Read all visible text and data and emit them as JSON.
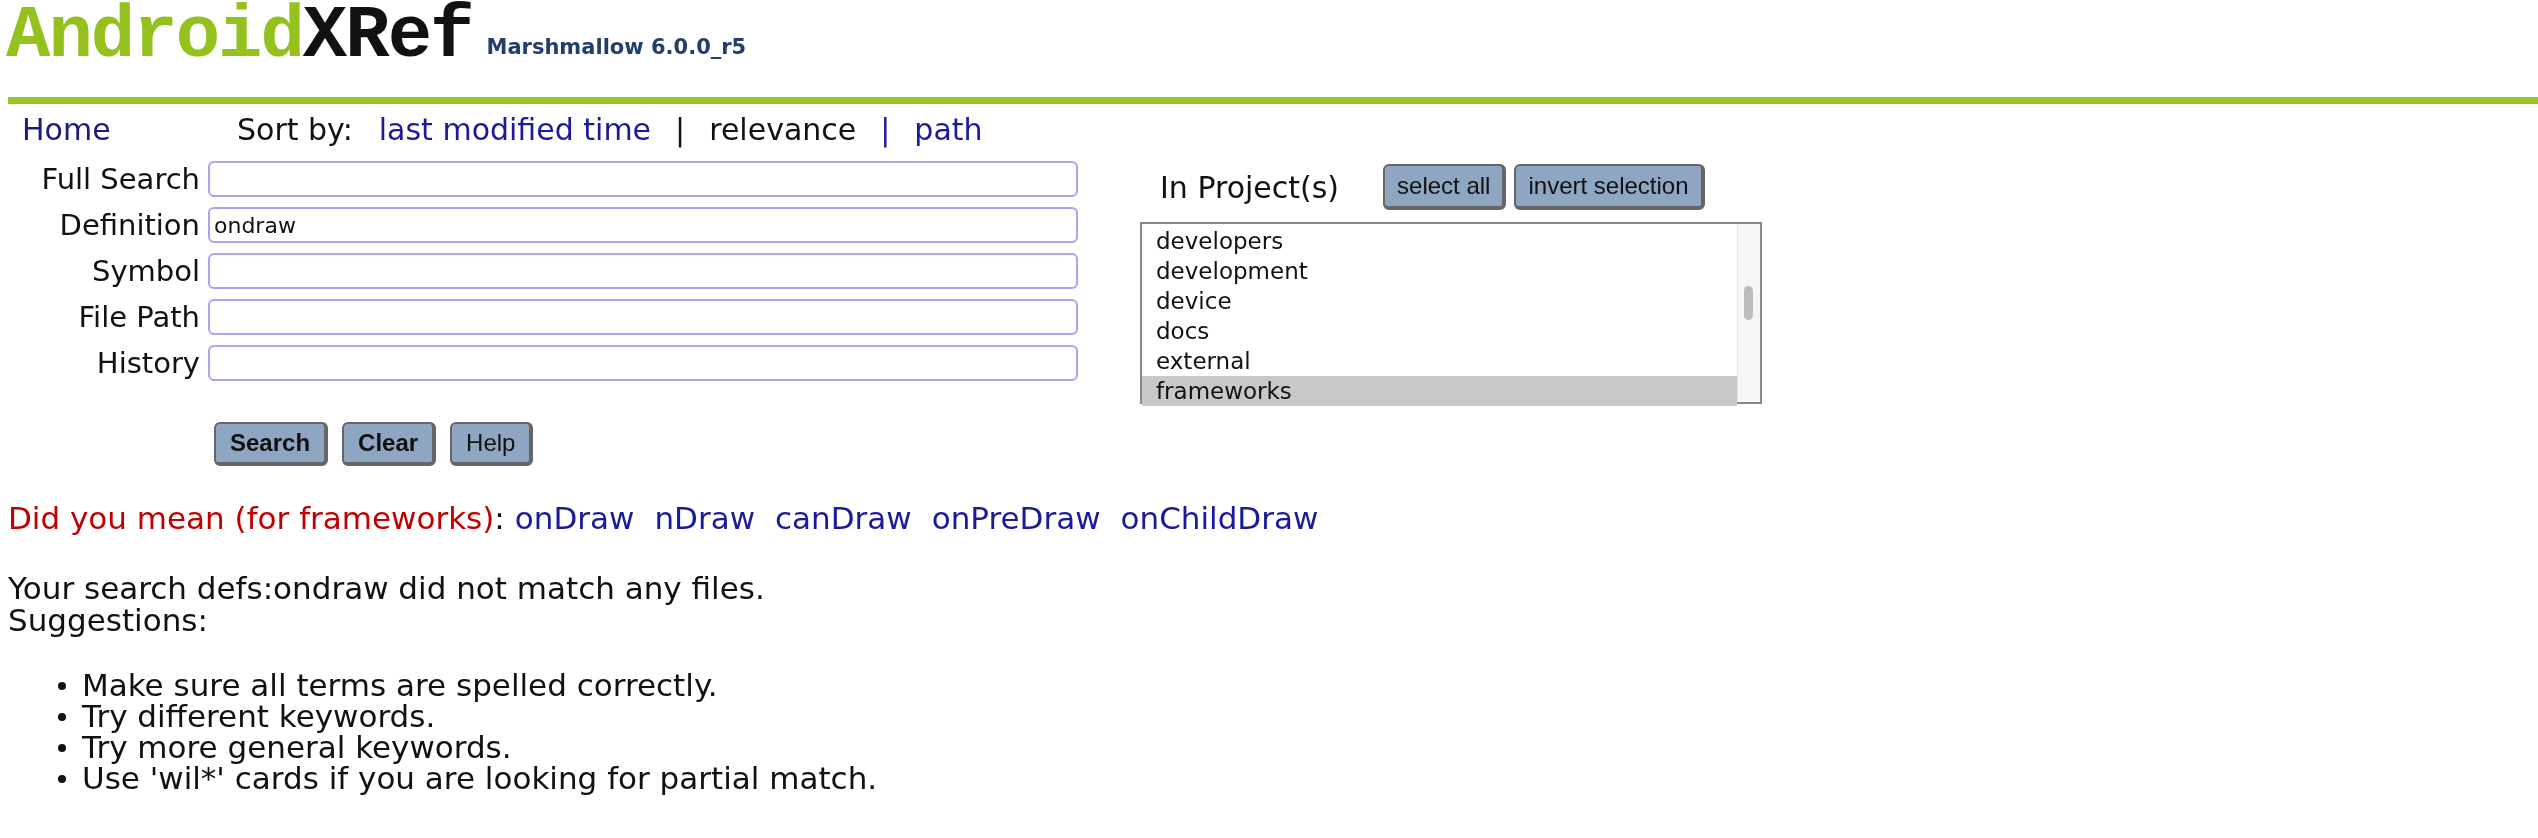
{
  "header": {
    "logo_first": "Android",
    "logo_second": "XRef",
    "version": "Marshmallow 6.0.0_r5"
  },
  "nav": {
    "home": "Home",
    "sort_label": "Sort by:",
    "sort_options": [
      {
        "label": "last modified time",
        "selected": false
      },
      {
        "label": "relevance",
        "selected": true
      },
      {
        "label": "path",
        "selected": false
      }
    ],
    "separators": [
      "|",
      "|"
    ]
  },
  "fields": [
    {
      "label": "Full Search"
    },
    {
      "label": "Definition",
      "value": "ondraw"
    },
    {
      "label": "Symbol"
    },
    {
      "label": "File Path"
    },
    {
      "label": "History"
    }
  ],
  "buttons": [
    {
      "label": "Search",
      "kind": "bold"
    },
    {
      "label": "Clear",
      "kind": "bold"
    },
    {
      "label": "Help",
      "kind": "plain"
    }
  ],
  "projects": {
    "label": "In Project(s)",
    "buttons": [
      "select all",
      "invert selection"
    ],
    "items": [
      {
        "label": "developers",
        "selected": false
      },
      {
        "label": "development",
        "selected": false
      },
      {
        "label": "device",
        "selected": false
      },
      {
        "label": "docs",
        "selected": false
      },
      {
        "label": "external",
        "selected": false
      },
      {
        "label": "frameworks",
        "selected": true
      }
    ]
  },
  "suggestion": {
    "prefix": "Did you mean (for frameworks)",
    "colon": ":",
    "terms": [
      "onDraw",
      "nDraw",
      "canDraw",
      "onPreDraw",
      "onChildDraw"
    ]
  },
  "message": "Your search defs:ondraw did not match any files.",
  "suggestions_label": "Suggestions:",
  "tips": [
    "Make sure all terms are spelled correctly.",
    "Try different keywords.",
    "Try more general keywords.",
    "Use 'wil*' cards if you are looking for partial match."
  ]
}
